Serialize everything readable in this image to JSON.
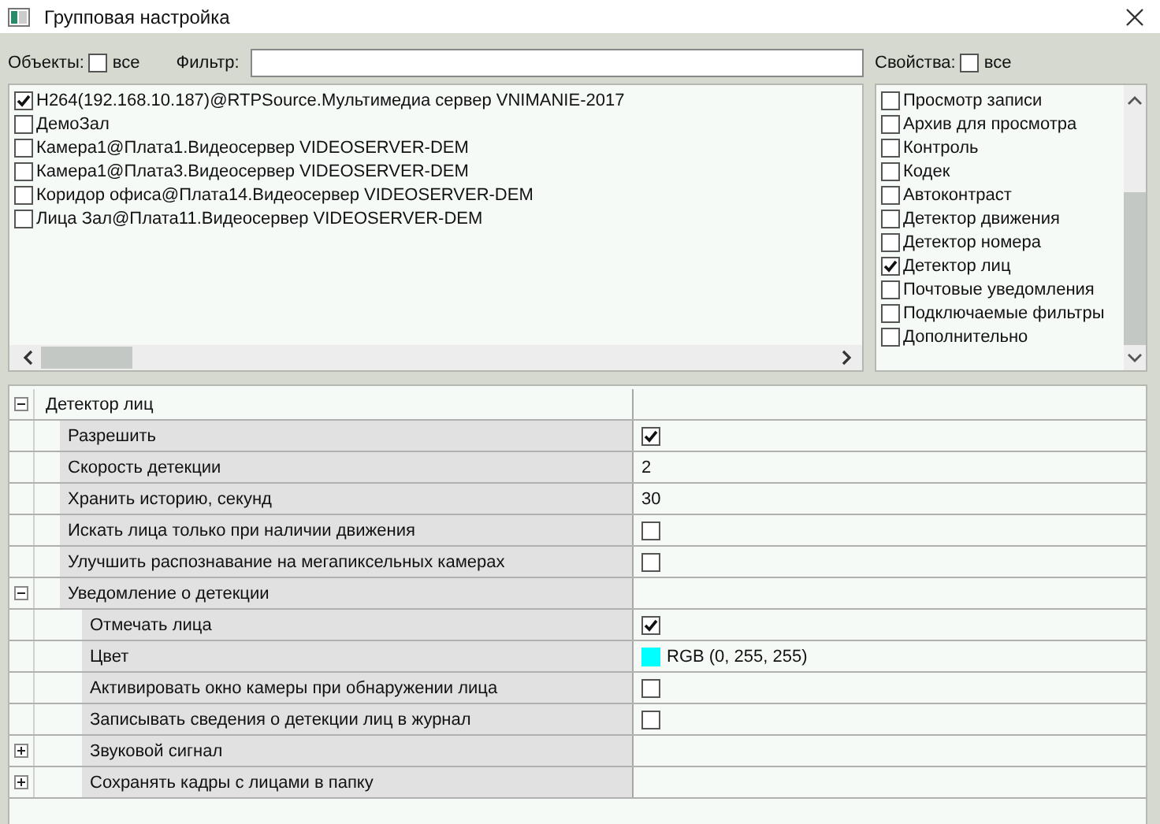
{
  "window": {
    "title": "Групповая настройка"
  },
  "objects": {
    "label": "Объекты:",
    "all_label": "все",
    "all_checked": false,
    "filter_label": "Фильтр:",
    "items": [
      {
        "label": "H264(192.168.10.187)@RTPSource.Мультимедиа сервер VNIMANIE-2017",
        "checked": true
      },
      {
        "label": "ДемоЗал",
        "checked": false
      },
      {
        "label": "Камера1@Плата1.Видеосервер VIDEOSERVER-DEM",
        "checked": false
      },
      {
        "label": "Камера1@Плата3.Видеосервер VIDEOSERVER-DEM",
        "checked": false
      },
      {
        "label": "Коридор офиса@Плата14.Видеосервер VIDEOSERVER-DEM",
        "checked": false
      },
      {
        "label": "Лица Зал@Плата11.Видеосервер VIDEOSERVER-DEM",
        "checked": false
      }
    ]
  },
  "properties": {
    "label": "Свойства:",
    "all_label": "все",
    "all_checked": false,
    "items": [
      {
        "label": "Просмотр записи",
        "checked": false
      },
      {
        "label": "Архив для просмотра",
        "checked": false
      },
      {
        "label": "Контроль",
        "checked": false
      },
      {
        "label": "Кодек",
        "checked": false
      },
      {
        "label": "Автоконтраст",
        "checked": false
      },
      {
        "label": "Детектор движения",
        "checked": false
      },
      {
        "label": "Детектор номера",
        "checked": false
      },
      {
        "label": "Детектор лиц",
        "checked": true
      },
      {
        "label": "Почтовые уведомления",
        "checked": false
      },
      {
        "label": "Подключаемые фильтры",
        "checked": false
      },
      {
        "label": "Дополнительно",
        "checked": false
      }
    ]
  },
  "grid": {
    "items": [
      {
        "kind": "group",
        "label": "Детектор лиц",
        "expanded": true,
        "children": [
          {
            "kind": "check",
            "label": "Разрешить",
            "checked": true
          },
          {
            "kind": "text",
            "label": "Скорость детекции",
            "value": "2"
          },
          {
            "kind": "text",
            "label": "Хранить историю, секунд",
            "value": "30"
          },
          {
            "kind": "check",
            "label": "Искать лица только при наличии движения",
            "checked": false
          },
          {
            "kind": "check",
            "label": "Улучшить распознавание на мегапиксельных камерах",
            "checked": false
          },
          {
            "kind": "group",
            "label": "Уведомление о детекции",
            "expanded": true,
            "children": [
              {
                "kind": "check",
                "label": "Отмечать лица",
                "checked": true
              },
              {
                "kind": "color",
                "label": "Цвет",
                "color": "#00ffff",
                "value": "RGB (0, 255, 255)"
              },
              {
                "kind": "check",
                "label": "Активировать окно камеры при обнаружении лица",
                "checked": false
              },
              {
                "kind": "check",
                "label": "Записывать сведения о детекции лиц в журнал",
                "checked": false
              },
              {
                "kind": "group",
                "label": "Звуковой сигнал",
                "expanded": false
              },
              {
                "kind": "group",
                "label": "Сохранять кадры с лицами в папку",
                "expanded": false
              }
            ]
          }
        ]
      }
    ]
  }
}
